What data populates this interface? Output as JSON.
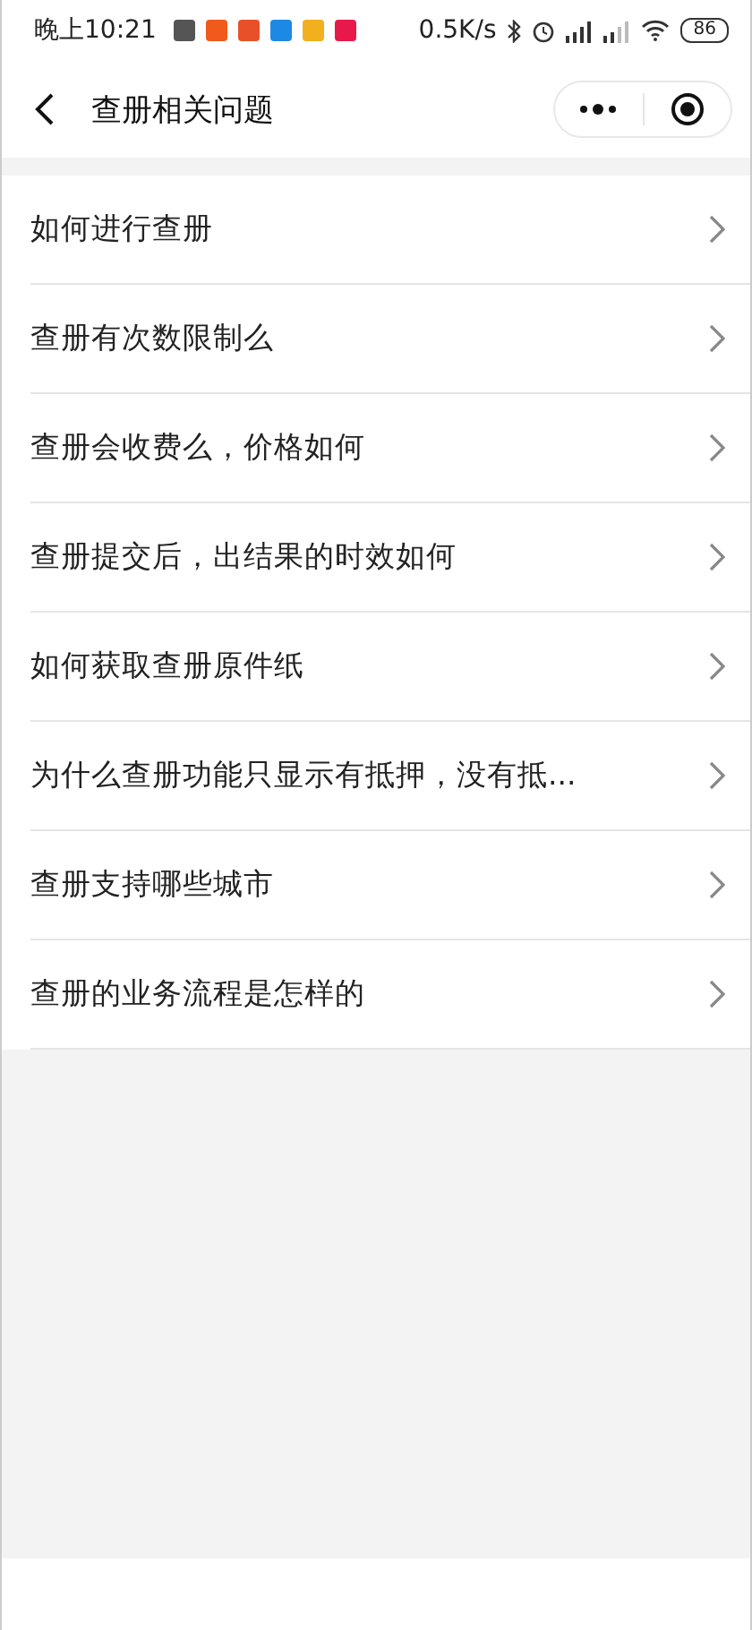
{
  "status_bar": {
    "time": "晚上10:21",
    "speed": "0.5K/s",
    "battery": "86",
    "notifications": [
      {
        "color": "#555555"
      },
      {
        "color": "#f05a1a"
      },
      {
        "color": "#e8502a"
      },
      {
        "color": "#1e88e5"
      },
      {
        "color": "#f2b01e"
      },
      {
        "color": "#e8194a"
      }
    ]
  },
  "nav": {
    "title": "查册相关问题"
  },
  "items": [
    {
      "label": "如何进行查册"
    },
    {
      "label": "查册有次数限制么"
    },
    {
      "label": "查册会收费么，价格如何"
    },
    {
      "label": "查册提交后，出结果的时效如何"
    },
    {
      "label": "如何获取查册原件纸"
    },
    {
      "label": "为什么查册功能只显示有抵押，没有抵..."
    },
    {
      "label": "查册支持哪些城市"
    },
    {
      "label": "查册的业务流程是怎样的"
    }
  ]
}
